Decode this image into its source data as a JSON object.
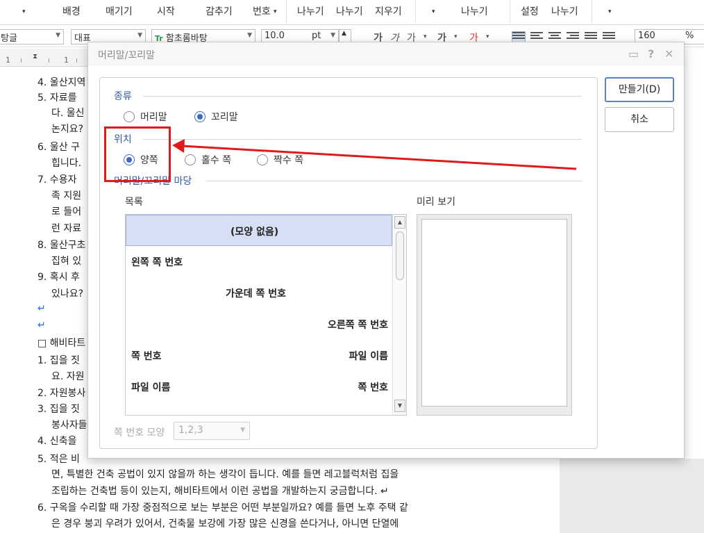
{
  "ribbon": {
    "top_row": [
      "배경",
      "매기기",
      "시작",
      "감추기",
      "번호",
      "나누기",
      "나누기",
      "지우기",
      "나누기",
      "설정",
      "나누기"
    ],
    "items": [
      "배경",
      "매기기",
      "시작",
      "감추기",
      "번호",
      "나누기",
      "나누기",
      "지우기",
      "나누기",
      "설정",
      "나누기"
    ]
  },
  "format_toolbar": {
    "style": "탕글",
    "lang": "대표",
    "font": "함초롬바탕",
    "size": "10.0",
    "unit": "pt",
    "char_buttons": [
      "가",
      "가",
      "가",
      "가",
      "가"
    ],
    "zoom": "160",
    "zoom_unit": "%"
  },
  "ruler": {
    "numbers": [
      "1",
      "1"
    ]
  },
  "document": {
    "lines": [
      "4. 울산지역",
      "5. 자료를",
      "다. 울신",
      "논지요?",
      "6. 울산 구",
      "힙니다.",
      "7. 수용자",
      "족 지원",
      "로 들어",
      "런 자료",
      "8. 울산구초",
      "집혀 있",
      "9. 혹시 후",
      "있나요?",
      "↵",
      "↵",
      "□ 해비타트",
      "1. 집을 짓",
      "요. 자원",
      "2. 자원봉사",
      "3. 집을 짓",
      "봉사자들",
      "4. 신축을",
      "5. 적은 비",
      "면, 특별한 건축 공법이 있지 않을까 하는 생각이 듭니다. 예를 들면 레고블럭처럼 집을",
      "조립하는 건축법 등이 있는지, 해비타트에서 이런 공법을 개발하는지 궁금합니다. ↵",
      "6. 구옥을 수리할 때 가장 중점적으로 보는 부분은 어떤 부분일까요? 예를 들면 노후 주택 같",
      "은 경우 붕괴 우려가 있어서, 건축물 보강에 가장 많은 신경을 쓴다거나, 아니면 단열에"
    ]
  },
  "dialog": {
    "title": "머리말/꼬리말",
    "sections": {
      "type": {
        "title": "종류",
        "options": [
          "머리말",
          "꼬리말"
        ],
        "selected": "꼬리말"
      },
      "position": {
        "title": "위치",
        "options": [
          "양쪽",
          "홀수 쪽",
          "짝수 쪽"
        ],
        "selected": "양쪽"
      },
      "template": {
        "title": "머리말/꼬리말 마당",
        "list_label": "목록",
        "preview_label": "미리 보기",
        "items": [
          {
            "left": "",
            "center": "(모양 없음)",
            "right": ""
          },
          {
            "left": "왼쪽 쪽 번호",
            "center": "",
            "right": ""
          },
          {
            "left": "",
            "center": "가운데 쪽 번호",
            "right": ""
          },
          {
            "left": "",
            "center": "",
            "right": "오른쪽 쪽 번호"
          },
          {
            "left": "쪽 번호",
            "center": "",
            "right": "파일 이름"
          },
          {
            "left": "파일 이름",
            "center": "",
            "right": "쪽 번호"
          }
        ],
        "selected_index": 0
      }
    },
    "page_number_format": {
      "label": "쪽 번호 모양",
      "value": "1,2,3"
    },
    "buttons": {
      "create": "만들기(D)",
      "cancel": "취소"
    }
  },
  "annotation": {
    "color": "#e01a1a"
  }
}
